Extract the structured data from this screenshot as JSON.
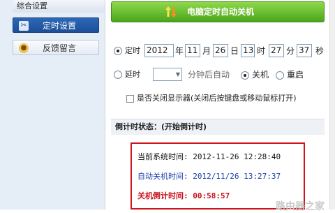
{
  "sidebar": {
    "heading": "综合设置",
    "items": [
      {
        "label": "定时设置",
        "icon": "tools-icon",
        "selected": true
      },
      {
        "label": "反馈留言",
        "icon": "user-icon",
        "selected": false
      }
    ]
  },
  "banner": {
    "title": "电脑定时自动关机",
    "icon": "up-down-arrows-icon"
  },
  "schedule": {
    "mode_label": "定时",
    "year": "2012",
    "year_unit": "年",
    "month": "11",
    "month_unit": "月",
    "day": "26",
    "day_unit": "日",
    "hour": "13",
    "hour_unit": "时",
    "minute": "27",
    "minute_unit": "分",
    "second": "37",
    "second_unit": "秒"
  },
  "delay": {
    "mode_label": "延时",
    "select_value": "",
    "suffix": "分钟后自动",
    "action_shutdown": "关机",
    "action_restart": "重启"
  },
  "monitor_option": {
    "label": "是否关闭显示器(关闭后按键盘或移动鼠标打开)"
  },
  "countdown": {
    "status": "倒计时状态：(开始倒计时)",
    "current_time": "当前系统时间:  2012-11-26 12:28:40",
    "shutdown_time": "自动关机时间:  2012/11/26 13:27:37",
    "remaining": "关机倒计时间:  00:58:57"
  },
  "watermark": "路由器之家",
  "colors": {
    "accent": "#1d4f98",
    "banner": "#5cb82a",
    "alert": "#d0121b"
  }
}
